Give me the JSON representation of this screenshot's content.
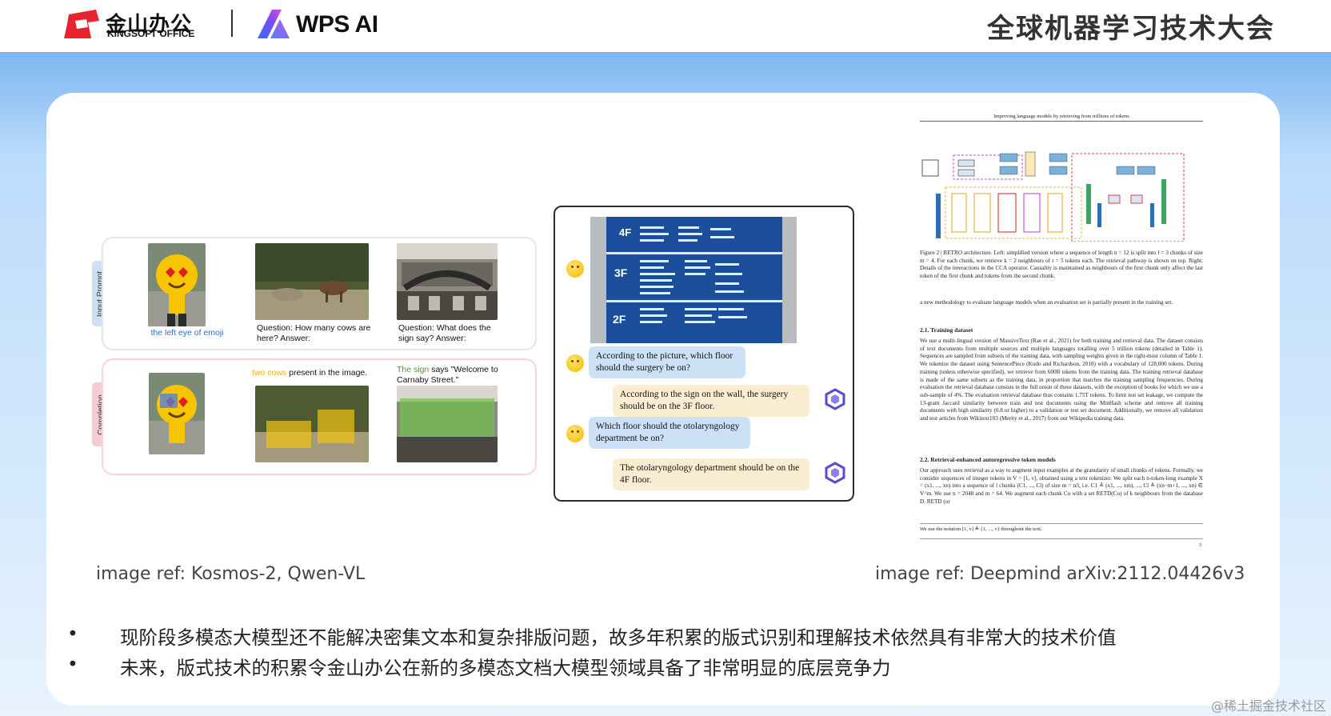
{
  "header": {
    "logo_cn": "金山办公",
    "logo_en": "KINGSOFT OFFICE",
    "wps_logo": "WPS AI",
    "conference_title": "全球机器学习技术大会"
  },
  "kosmos": {
    "input_tab": "Input Prompt",
    "completion_tab": "Completion",
    "prompt_1": "the left eye of emoji",
    "prompt_2": "Question: How many cows are here? Answer:",
    "prompt_3": "Question: What does the sign say? Answer:",
    "completion_2_highlight": "two cows",
    "completion_2_rest": " present in the image.",
    "completion_3_highlight": "The sign",
    "completion_3_rest": " says \"Welcome to Carnaby Street.\""
  },
  "qwen_chat": {
    "sign_floors": [
      "4F",
      "3F",
      "2F"
    ],
    "messages": [
      {
        "role": "user",
        "text": "According to the picture, which floor should the surgery be on?"
      },
      {
        "role": "assistant",
        "text": "According to the sign on the wall, the surgery should be on the 3F floor."
      },
      {
        "role": "user",
        "text": "Which floor should the otolaryngology department be on?"
      },
      {
        "role": "assistant",
        "text": "The otolaryngology department should be on the 4F floor."
      }
    ]
  },
  "paper": {
    "title": "Improving language models by retrieving from trillions of tokens",
    "caption": "Figure 2 | RETRO architecture. Left: simplified version where a sequence of length n = 12 is split into l = 3 chunks of size m = 4. For each chunk, we retrieve k = 2 neighbours of r = 5 tokens each. The retrieval pathway is shown on top. Right: Details of the interactions in the CCA operator. Causality is maintained as neighbours of the first chunk only affect the last token of the first chunk and tokens from the second chunk.",
    "intro": "a new methodology to evaluate language models when an evaluation set is partially present in the training set.",
    "section_1": "2.1. Training dataset",
    "section_1_text": "We use a multi-lingual version of MassiveText (Rae et al., 2021) for both training and retrieval data. The dataset consists of text documents from multiple sources and multiple languages totalling over 5 trillion tokens (detailed in Table 1). Sequences are sampled from subsets of the training data, with sampling weights given in the right-most column of Table 1. We tokenize the dataset using SentencePiece (Kudo and Richardson, 2018) with a vocabulary of 128,000 tokens. During training (unless otherwise specified), we retrieve from 600B tokens from the training data. The training retrieval database is made of the same subsets as the training data, in proportion that matches the training sampling frequencies. During evaluation the retrieval database consists in the full union of these datasets, with the exception of books for which we use a sub-sample of 4%. The evaluation retrieval database thus contains 1.75T tokens. To limit test set leakage, we compute the 13-gram Jaccard similarity between train and test documents using the MinHash scheme and remove all training documents with high similarity (0.8 or higher) to a validation or test set document. Additionally, we remove all validation and test articles from Wikitext103 (Merity et al., 2017) from our Wikipedia training data.",
    "section_2": "2.2. Retrieval-enhanced autoregressive token models",
    "section_2_text": "Our approach uses retrieval as a way to augment input examples at the granularity of small chunks of tokens. Formally, we consider sequences of integer tokens in V = [1, v], obtained using a text tokenizer. We split each n-token-long example X = (x1, ..., xn) into a sequence of l chunks (C1, ..., Cl) of size m = n/l, i.e. C1 ≜ (x1, ..., xm), ..., Cl ≜ (xn−m+1, ..., xn) ∈ V^m. We use n = 2048 and m = 64. We augment each chunk Cu with a set RETD(Cu) of k neighbours from the database D. RETD (or",
    "footnote": "We use the notation [1, v] ≜ {1, ..., v} throughout the text.",
    "page_number": "3"
  },
  "refs": {
    "left": "image ref: Kosmos-2, Qwen-VL",
    "right": "image ref: Deepmind arXiv:2112.04426v3"
  },
  "bullets": [
    "现阶段多模态大模型还不能解决密集文本和复杂排版问题，故多年积累的版式识别和理解技术依然具有非常大的技术价值",
    "未来，版式技术的积累令金山办公在新的多模态文档大模型领域具备了非常明显的底层竞争力"
  ],
  "bullet_symbol": "•",
  "watermark": "@稀土掘金技术社区",
  "colors": {
    "kingsoft_red": "#e8232e",
    "wps_gradient": [
      "#3a6cf6",
      "#c23fe6"
    ],
    "question_bubble": "#cde1f6",
    "answer_bubble": "#fbedd2"
  }
}
